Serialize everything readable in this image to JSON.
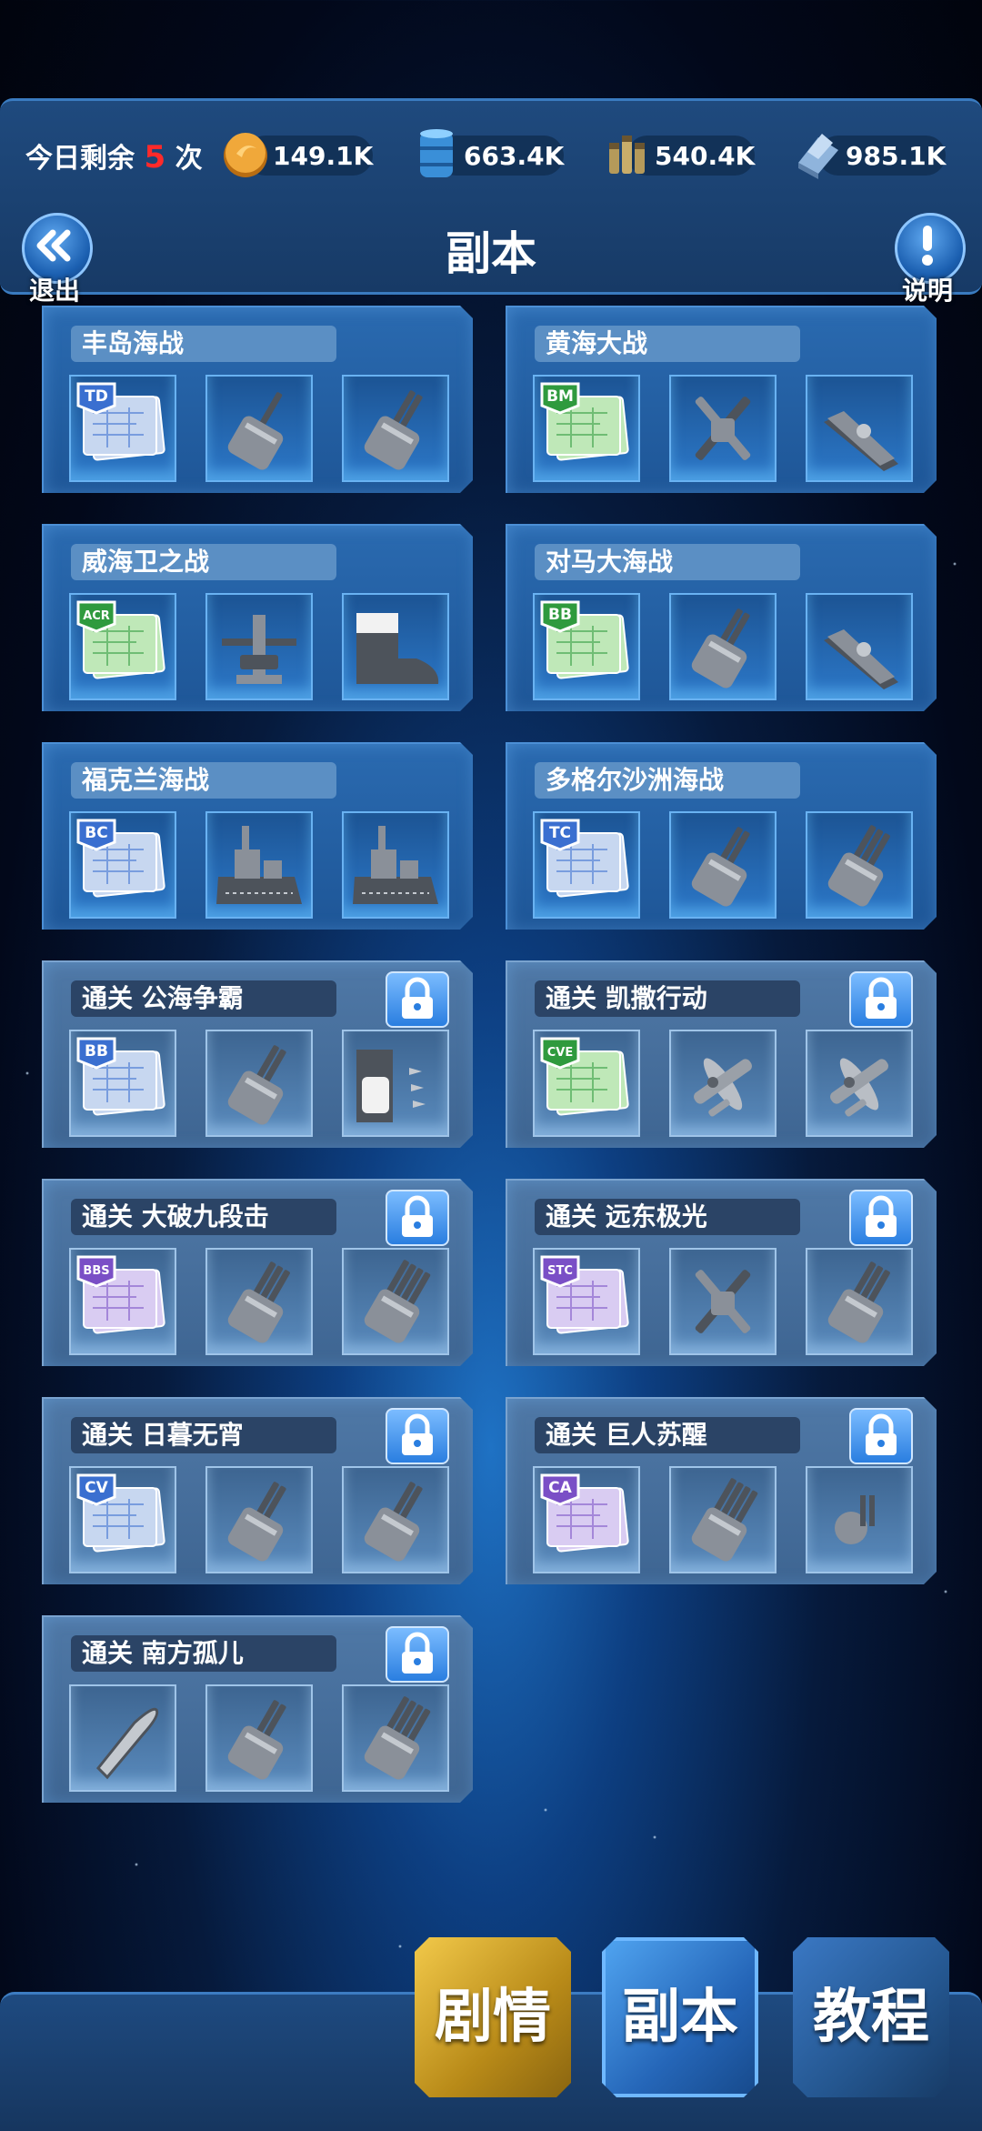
{
  "header": {
    "remain_prefix": "今日剩余",
    "remain_count": "5",
    "remain_suffix": "次",
    "resources": [
      {
        "icon": "coin-icon",
        "value": "149.1K"
      },
      {
        "icon": "oil-barrel-icon",
        "value": "663.4K"
      },
      {
        "icon": "ammo-shells-icon",
        "value": "540.4K"
      },
      {
        "icon": "steel-icon",
        "value": "985.1K"
      }
    ],
    "title": "副本",
    "back_label": "退出",
    "help_label": "说明"
  },
  "dungeons": [
    {
      "name": "丰岛海战",
      "locked": false,
      "blueprint": "TD",
      "blueprint_color": "blue",
      "rewards": [
        "single-gun-turret-icon",
        "twin-gun-turret-icon"
      ]
    },
    {
      "name": "黄海大战",
      "locked": false,
      "blueprint": "BM",
      "blueprint_color": "green",
      "rewards": [
        "crossed-guns-icon",
        "deck-plate-icon"
      ]
    },
    {
      "name": "威海卫之战",
      "locked": false,
      "blueprint": "ACR",
      "blueprint_color": "green",
      "rewards": [
        "radar-mast-icon",
        "bow-hull-icon"
      ]
    },
    {
      "name": "对马大海战",
      "locked": false,
      "blueprint": "BB",
      "blueprint_color": "green",
      "rewards": [
        "heavy-turret-icon",
        "launch-rail-icon"
      ]
    },
    {
      "name": "福克兰海战",
      "locked": false,
      "blueprint": "BC",
      "blueprint_color": "blue",
      "rewards": [
        "superstructure-icon",
        "ship-section-icon"
      ]
    },
    {
      "name": "多格尔沙洲海战",
      "locked": false,
      "blueprint": "TC",
      "blueprint_color": "blue",
      "rewards": [
        "twin-turret-icon",
        "triple-turret-icon"
      ]
    },
    {
      "name": "通关 公海争霸",
      "locked": true,
      "blueprint": "BB",
      "blueprint_color": "blue",
      "rewards": [
        "heavy-turret-icon",
        "armor-module-icon"
      ]
    },
    {
      "name": "通关 凯撒行动",
      "locked": true,
      "blueprint": "CVE",
      "blueprint_color": "green",
      "rewards": [
        "fighter-plane-icon",
        "bomber-plane-icon"
      ]
    },
    {
      "name": "通关 大破九段击",
      "locked": true,
      "blueprint": "BBS",
      "blueprint_color": "purple",
      "rewards": [
        "triple-heavy-turret-icon",
        "quad-heavy-turret-icon"
      ]
    },
    {
      "name": "通关 远东极光",
      "locked": true,
      "blueprint": "STC",
      "blueprint_color": "purple",
      "rewards": [
        "missile-pod-icon",
        "missile-launcher-icon"
      ]
    },
    {
      "name": "通关 日暮无宵",
      "locked": true,
      "blueprint": "CV",
      "blueprint_color": "blue",
      "rewards": [
        "red-fighter-icon",
        "red-bomber-icon"
      ]
    },
    {
      "name": "通关 巨人苏醒",
      "locked": true,
      "blueprint": "CA",
      "blueprint_color": "purple",
      "rewards": [
        "quad-turret-icon",
        "small-gun-mount-icon"
      ]
    },
    {
      "name": "通关 南方孤儿",
      "locked": true,
      "blueprint": "",
      "blueprint_color": "none",
      "rewards": [
        "shell-icon",
        "twin-turret-icon",
        "quad-turret-icon"
      ]
    }
  ],
  "nav": {
    "story": "剧情",
    "dungeon": "副本",
    "tutorial": "教程"
  }
}
